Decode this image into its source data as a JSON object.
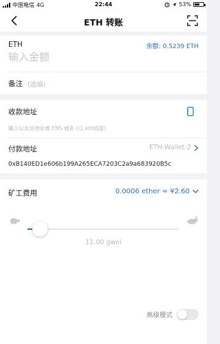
{
  "status_bar": {
    "carrier": "中国电信",
    "network": "4G",
    "time": "22:44",
    "battery": "53%",
    "battery_level": 0.53
  },
  "nav": {
    "title": "ETH 转账",
    "back_icon": "chevron-left-icon",
    "scan_icon": "scan-icon"
  },
  "transfer": {
    "token_label": "ETH",
    "balance": "余额: 0.5239 ETH",
    "amount_placeholder": "输入金额",
    "memo_label": "备注",
    "memo_hint": "(选填)"
  },
  "receiver": {
    "label": "收款地址",
    "address_placeholder": "输入以太坊地址或 ENS 域名 (以.eth结尾)",
    "contacts_icon": "address-book-icon"
  },
  "payer": {
    "label": "付款地址",
    "wallet_name": "ETH-Wallet-2",
    "address": "0xB140ED1e606b199A265ECA7203C2a9a683920B5c"
  },
  "fee": {
    "label": "矿工费用",
    "value": "0.0006 ether ≈ ¥2.60",
    "gwei": "11.00 gwei",
    "slider_fraction": 0.08,
    "slow_icon": "turtle-icon",
    "fast_icon": "rabbit-icon"
  },
  "advanced": {
    "label": "高级模式",
    "enabled": false
  },
  "colors": {
    "accent": "#2d6fb7",
    "muted": "#b6b9c0",
    "background": "#f2f2f5"
  }
}
